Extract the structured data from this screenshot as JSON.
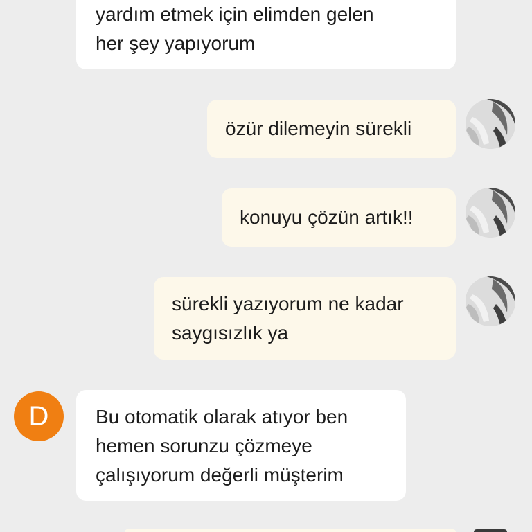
{
  "messages": [
    {
      "sender": "agent",
      "lines": [
        "yardım etmek için elimden gelen",
        "her şey yapıyorum"
      ]
    },
    {
      "sender": "user",
      "lines": [
        "özür dilemeyin sürekli"
      ]
    },
    {
      "sender": "user",
      "lines": [
        "konuyu çözün artık!!"
      ]
    },
    {
      "sender": "user",
      "lines": [
        "sürekli yazıyorum ne kadar",
        "saygısızlık ya"
      ]
    },
    {
      "sender": "agent",
      "avatar_initial": "D",
      "lines": [
        "Bu otomatik olarak atıyor ben",
        "hemen sorunzu çözmeye",
        "çalışıyorum değerli müşterim"
      ]
    }
  ],
  "colors": {
    "background": "#ededed",
    "agent_bubble": "#ffffff",
    "user_bubble": "#fdf8ea",
    "agent_avatar": "#f07f12"
  },
  "icons": {
    "user_avatar": "user-photo-avatar",
    "agent_avatar": "letter-avatar"
  }
}
